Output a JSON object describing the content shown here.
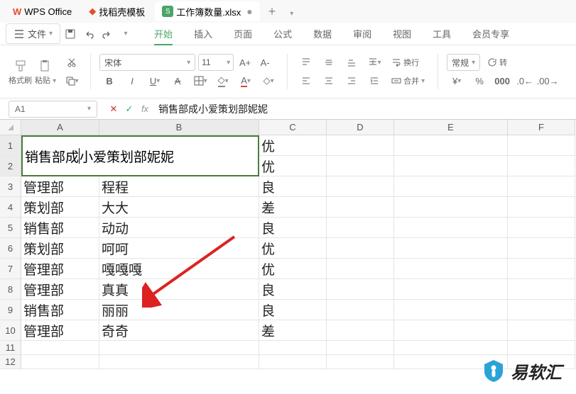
{
  "title_bar": {
    "app_name": "WPS Office",
    "docer_tab": "找稻壳模板",
    "sheet_icon": "S",
    "file_tab": "工作簿数量.xlsx",
    "add": "+"
  },
  "menu": {
    "file_label": "文件",
    "tabs": [
      "开始",
      "插入",
      "页面",
      "公式",
      "数据",
      "审阅",
      "视图",
      "工具",
      "会员专享"
    ]
  },
  "toolbar": {
    "format_painter": "格式刷",
    "paste": "粘贴",
    "font_name": "宋体",
    "font_size": "11",
    "a_plus": "A+",
    "a_minus": "A-",
    "wrap_text": "换行",
    "merge": "合并",
    "style_select": "常规",
    "rotate": "转"
  },
  "formula_bar": {
    "name_box": "A1",
    "formula": "销售部成小爱策划部妮妮"
  },
  "columns": [
    "A",
    "B",
    "C",
    "D",
    "E",
    "F"
  ],
  "rows": [
    1,
    2,
    3,
    4,
    5,
    6,
    7,
    8,
    9,
    10,
    11,
    12
  ],
  "merged": {
    "prefix": "销售部成",
    "suffix": "小爱策划部妮妮"
  },
  "data": {
    "c1": "优",
    "c2": "优",
    "a3": "管理部",
    "b3": "程程",
    "c3": "良",
    "a4": "策划部",
    "b4": "大大",
    "c4": "差",
    "a5": "销售部",
    "b5": "动动",
    "c5": "良",
    "a6": "策划部",
    "b6": "呵呵",
    "c6": "优",
    "a7": "管理部",
    "b7": "嘎嘎嘎",
    "c7": "优",
    "a8": "管理部",
    "b8": "真真",
    "c8": "良",
    "a9": "销售部",
    "b9": "丽丽",
    "c9": "良",
    "a10": "管理部",
    "b10": "奇奇",
    "c10": "差"
  },
  "watermark": "易软汇"
}
